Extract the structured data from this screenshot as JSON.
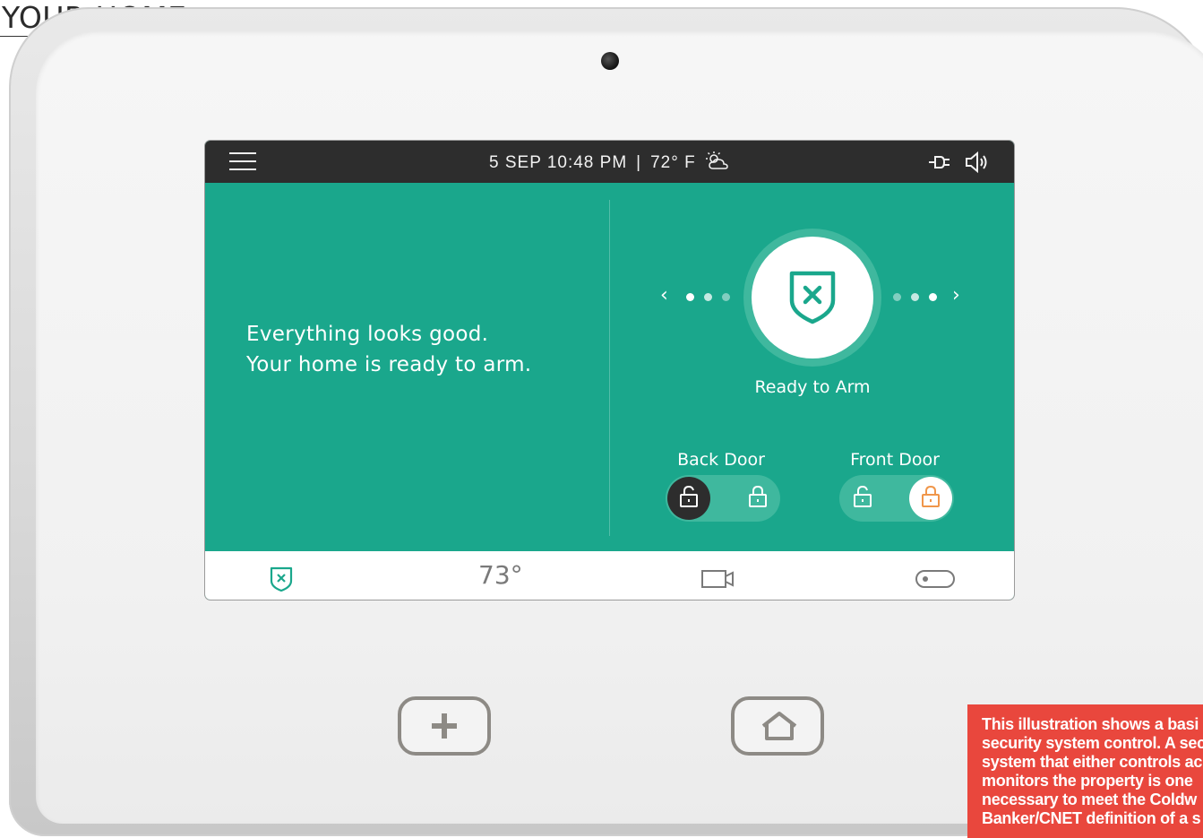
{
  "page": {
    "header": "YOUR HOME",
    "caption_lines": [
      "This illustration shows a basi",
      "security system control. A sec",
      "system that either controls ac",
      "monitors the property is one",
      "necessary to meet the Coldw",
      "Banker/CNET definition of a s"
    ]
  },
  "status_bar": {
    "datetime": "5 SEP 10:48 PM",
    "separator": "|",
    "outdoor_temp": "72° F",
    "icons": [
      "menu-icon",
      "weather-partly-cloudy-icon",
      "power-plug-icon",
      "speaker-icon"
    ]
  },
  "main": {
    "message_line1": "Everything looks good.",
    "message_line2": "Your home is ready to arm.",
    "arm_status": "Ready to Arm",
    "nav_prev": "‹",
    "nav_next": "›",
    "locks": [
      {
        "label": "Back Door",
        "state": "unlocked"
      },
      {
        "label": "Front Door",
        "state": "locked"
      }
    ]
  },
  "tab_bar": {
    "thermostat_temp": "73°",
    "icons": [
      "shield-x-icon",
      "camera-icon",
      "toggle-switch-icon"
    ]
  },
  "hardware_buttons": [
    "plus-icon",
    "home-icon"
  ],
  "colors": {
    "screen_green": "#1aa78c",
    "status_bar": "#2d2d2d",
    "lock_accent": "#f0964a",
    "caption_red": "#e9473d"
  }
}
